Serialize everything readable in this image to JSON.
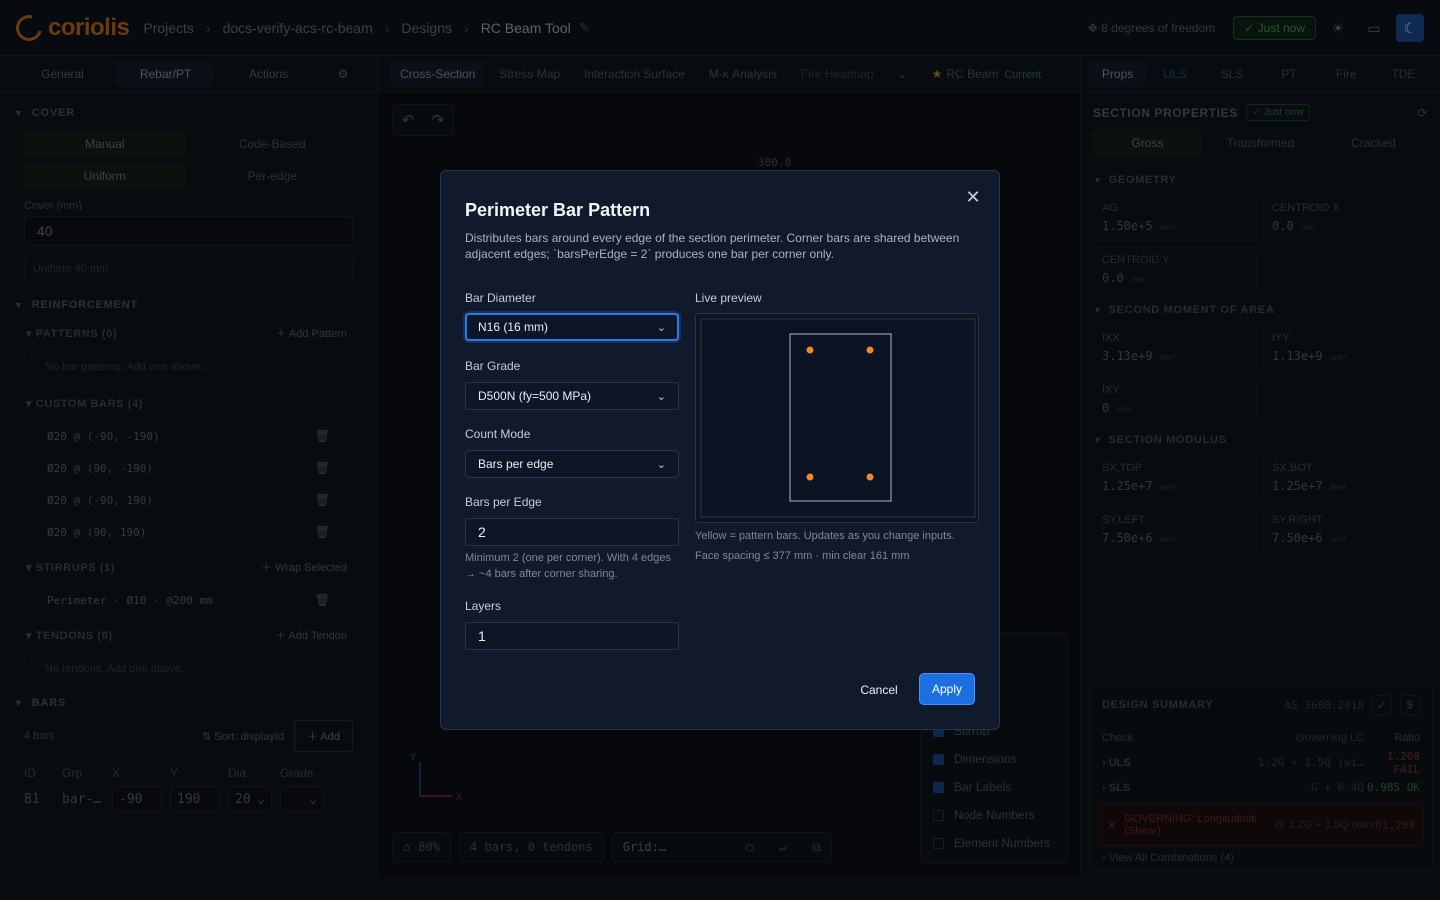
{
  "topbar": {
    "logo_text": "coriolis",
    "crumbs": [
      "Projects",
      "docs-verify-acs-rc-beam",
      "Designs",
      "RC Beam Tool"
    ],
    "dof": "8 degrees of freedom",
    "saved": "Just now"
  },
  "left": {
    "tabs": [
      "General",
      "Rebar/PT",
      "Actions"
    ],
    "cover_title": "COVER",
    "cover_mode": [
      "Manual",
      "Code-Based"
    ],
    "cover_edge": [
      "Uniform",
      "Per-edge"
    ],
    "cover_label": "Cover (mm)",
    "cover_value": "40",
    "cover_hint": "Uniform 40 mm",
    "reinforcement_title": "REINFORCEMENT",
    "patterns_title": "PATTERNS (0)",
    "patterns_action": "Add Pattern",
    "patterns_empty": "No bar patterns. Add one above.",
    "custom_title": "CUSTOM BARS (4)",
    "custom_bars": [
      "Ø20 @ (-90, -190)",
      "Ø20 @ (90, -190)",
      "Ø20 @ (-90, 190)",
      "Ø20 @ (90, 190)"
    ],
    "stirrups_title": "STIRRUPS (1)",
    "stirrups_action": "Wrap Selected",
    "stirrup_row": "Perimeter · Ø10 · @200 mm",
    "tendons_title": "TENDONS (0)",
    "tendons_action": "Add Tendon",
    "tendons_empty": "No tendons. Add one above.",
    "bars_title": "BARS",
    "bars_count": "4 bars",
    "sort_label": "Sort: displayId",
    "add_label": "Add",
    "table_headers": [
      "ID",
      "Grp",
      "X",
      "Y",
      "Dia",
      "Grade"
    ],
    "table_row": {
      "id": "B1",
      "grp": "bar-…",
      "x": "-90",
      "y": "190",
      "dia": "20"
    }
  },
  "center": {
    "tabs": [
      "Cross-Section",
      "Stress Map",
      "Interaction Surface",
      "M-κ Analysis",
      "Fire Heatmap"
    ],
    "variant": "RC Beam",
    "variant_status": "Current",
    "dim_label": "300.0",
    "layers": [
      "Stirrup",
      "Dimensions",
      "Bar Labels",
      "Node Numbers",
      "Element Numbers"
    ],
    "zoom": "80%",
    "counts": "4 bars, 0 tendons",
    "grid": "Grid:…",
    "axis_x": "X",
    "axis_y": "Y"
  },
  "right": {
    "tabs": [
      "Props",
      "ULS",
      "SLS",
      "PT",
      "Fire",
      "TDE"
    ],
    "section_title": "SECTION PROPERTIES",
    "section_pill": "Just now",
    "modes": [
      "Gross",
      "Transformed",
      "Cracked"
    ],
    "geometry_title": "GEOMETRY",
    "geometry": [
      {
        "k": "AG",
        "v": "1.50e+5",
        "u": "mm²"
      },
      {
        "k": "CENTROID X",
        "v": "0.0",
        "u": "mm"
      },
      {
        "k": "CENTROID Y",
        "v": "0.0",
        "u": "mm"
      }
    ],
    "moment_title": "SECOND MOMENT OF AREA",
    "moments": [
      {
        "k": "IXX",
        "v": "3.13e+9",
        "u": "mm⁴"
      },
      {
        "k": "IYY",
        "v": "1.13e+9",
        "u": "mm⁴"
      },
      {
        "k": "IXY",
        "v": "0",
        "u": "mm⁴"
      }
    ],
    "modulus_title": "SECTION MODULUS",
    "moduli": [
      {
        "k": "SX,TOP",
        "v": "1.25e+7",
        "u": "mm³"
      },
      {
        "k": "SX,BOT",
        "v": "1.25e+7",
        "u": "mm³"
      },
      {
        "k": "SY,LEFT",
        "v": "7.50e+6",
        "u": "mm³"
      },
      {
        "k": "SY,RIGHT",
        "v": "7.50e+6",
        "u": "mm³"
      }
    ],
    "design_title": "DESIGN SUMMARY",
    "design_std": "AS 3600:2018",
    "design_headers": [
      "Check",
      "Governing LC",
      "Ratio"
    ],
    "design_rows": [
      {
        "check": "ULS",
        "lc": "1.2G + 1.5Q (wi…",
        "ratio": "1.208",
        "status": "FAIL"
      },
      {
        "check": "SLS",
        "lc": "G + 0.4Q",
        "ratio": "0.985",
        "status": "OK"
      }
    ],
    "governing": {
      "label": "GOVERNING: Longitudinal (Shear)",
      "lc": "@ 1.2G + 1.5Q (wind)",
      "ratio": "1.208"
    },
    "view_all": "View All Combinations (4)"
  },
  "modal": {
    "title": "Perimeter Bar Pattern",
    "description": "Distributes bars around every edge of the section perimeter. Corner bars are shared between adjacent edges; `barsPerEdge = 2` produces one bar per corner only.",
    "diameter_label": "Bar Diameter",
    "diameter_value": "N16 (16 mm)",
    "grade_label": "Bar Grade",
    "grade_value": "D500N (fy=500 MPa)",
    "count_label": "Count Mode",
    "count_value": "Bars per edge",
    "per_edge_label": "Bars per Edge",
    "per_edge_value": "2",
    "per_edge_help": "Minimum 2 (one per corner). With 4 edges → ~4 bars after corner sharing.",
    "layers_label": "Layers",
    "layers_value": "1",
    "preview_label": "Live preview",
    "preview_note": "Yellow = pattern bars. Updates as you change inputs.",
    "preview_spacing": "Face spacing ≤ 377 mm · min clear 161 mm",
    "cancel": "Cancel",
    "apply": "Apply",
    "bar_color": "#f0852a"
  }
}
